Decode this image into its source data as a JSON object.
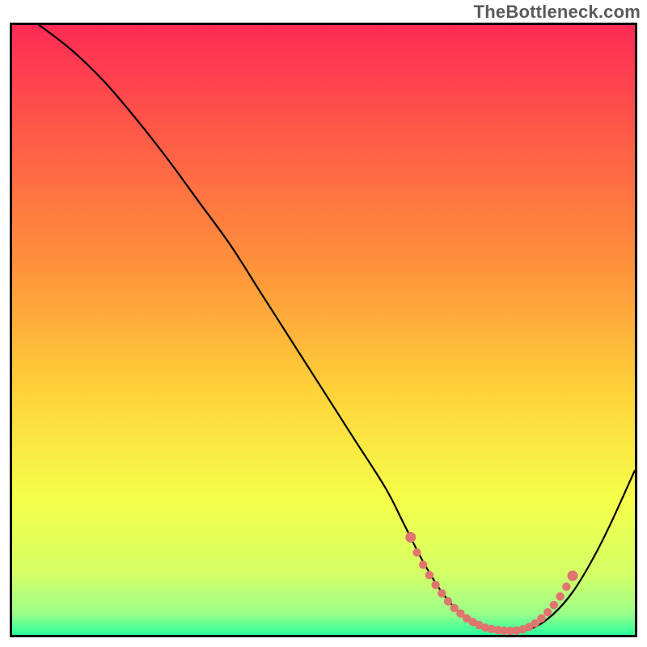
{
  "watermark": "TheBottleneck.com",
  "chart_data": {
    "type": "line",
    "title": "",
    "xlabel": "",
    "ylabel": "",
    "xlim": [
      0,
      100
    ],
    "ylim": [
      0,
      100
    ],
    "background_gradient": {
      "stops": [
        {
          "offset": 0.0,
          "color": "#ff2a55"
        },
        {
          "offset": 0.18,
          "color": "#ff5a47"
        },
        {
          "offset": 0.4,
          "color": "#ff933a"
        },
        {
          "offset": 0.6,
          "color": "#ffd23a"
        },
        {
          "offset": 0.78,
          "color": "#f5ff4a"
        },
        {
          "offset": 0.9,
          "color": "#d4ff66"
        },
        {
          "offset": 0.965,
          "color": "#9bff8a"
        },
        {
          "offset": 1.0,
          "color": "#2bff9e"
        }
      ]
    },
    "series": [
      {
        "name": "bottleneck-curve",
        "color": "#000000",
        "x": [
          0,
          5,
          10,
          15,
          20,
          25,
          30,
          35,
          40,
          45,
          50,
          55,
          60,
          63,
          66,
          69,
          72,
          75,
          78,
          81,
          84,
          87,
          90,
          93,
          96,
          100
        ],
        "values": [
          103,
          99.5,
          95.5,
          90.5,
          84.5,
          78,
          71,
          64,
          56,
          48,
          40,
          32,
          24,
          18,
          12,
          7,
          3.5,
          1.5,
          0.6,
          0.5,
          1.3,
          3.5,
          7,
          12,
          18,
          27
        ]
      },
      {
        "name": "optimal-range-marker",
        "color": "#e0746e",
        "style": "dotted-thick",
        "x": [
          64,
          65,
          66,
          67,
          68,
          69,
          70,
          71,
          72,
          73,
          74,
          75,
          76,
          77,
          78,
          79,
          80,
          81,
          82,
          83,
          84,
          85,
          86,
          87,
          88,
          89,
          90
        ],
        "values": [
          16,
          13.5,
          11.5,
          9.8,
          8.2,
          6.8,
          5.5,
          4.4,
          3.5,
          2.7,
          2.1,
          1.6,
          1.2,
          0.95,
          0.8,
          0.7,
          0.65,
          0.7,
          0.9,
          1.3,
          1.9,
          2.7,
          3.7,
          4.9,
          6.3,
          7.9,
          9.7
        ]
      }
    ]
  }
}
